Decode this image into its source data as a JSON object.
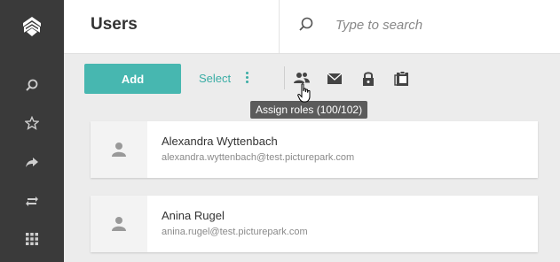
{
  "header": {
    "title": "Users",
    "search_placeholder": "Type to search"
  },
  "sidebar": {
    "items": [
      {
        "icon": "search-icon"
      },
      {
        "icon": "star-icon"
      },
      {
        "icon": "share-arrow-icon"
      },
      {
        "icon": "swap-arrows-icon"
      },
      {
        "icon": "grid-icon"
      }
    ]
  },
  "toolbar": {
    "add_label": "Add",
    "select_label": "Select",
    "actions": [
      "assign-roles-icon",
      "mail-icon",
      "lock-icon",
      "clipboard-icon"
    ],
    "tooltip": "Assign roles (100/102)"
  },
  "users": [
    {
      "name": "Alexandra Wyttenbach",
      "email": "alexandra.wyttenbach@test.picturepark.com"
    },
    {
      "name": "Anina Rugel",
      "email": "anina.rugel@test.picturepark.com"
    }
  ],
  "colors": {
    "accent": "#47b7b0",
    "sidebar": "#3a3a3a"
  }
}
